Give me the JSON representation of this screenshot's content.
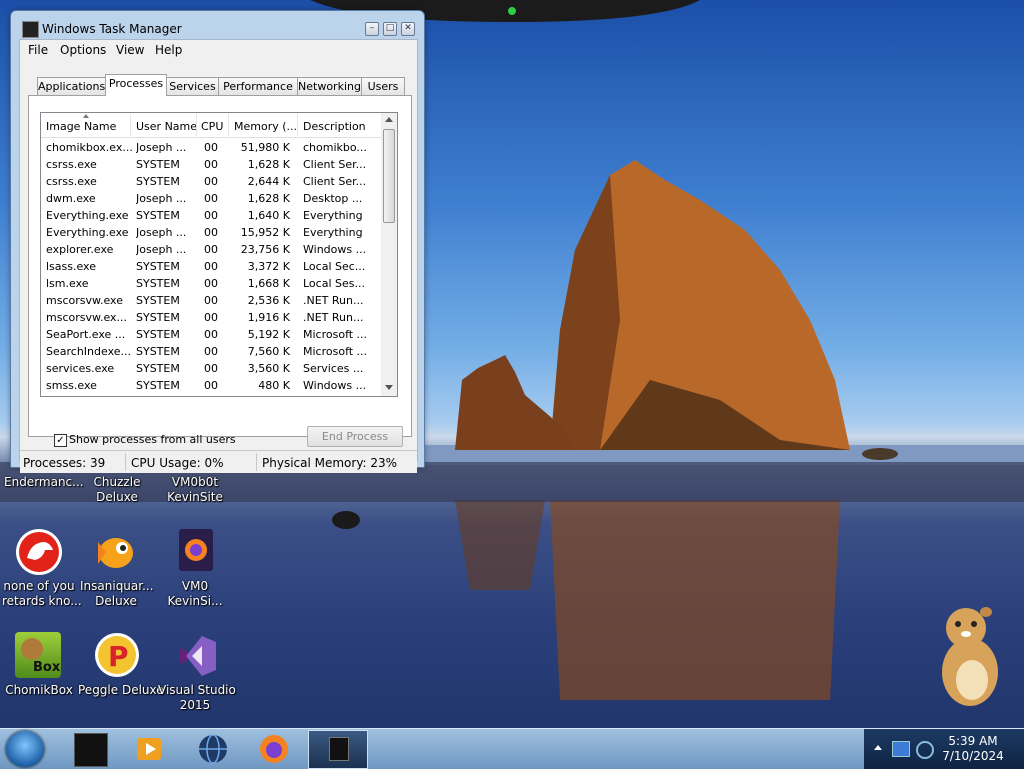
{
  "window": {
    "title": "Windows Task Manager",
    "menu": [
      "File",
      "Options",
      "View",
      "Help"
    ],
    "tabs": [
      "Applications",
      "Processes",
      "Services",
      "Performance",
      "Networking",
      "Users"
    ],
    "active_tab": "Processes",
    "columns": [
      "Image Name",
      "User Name",
      "CPU",
      "Memory (...",
      "Description"
    ],
    "processes": [
      [
        "chomikbox.ex...",
        "Joseph ...",
        "00",
        "51,980 K",
        "chomikbo..."
      ],
      [
        "csrss.exe",
        "SYSTEM",
        "00",
        "1,628 K",
        "Client Ser..."
      ],
      [
        "csrss.exe",
        "SYSTEM",
        "00",
        "2,644 K",
        "Client Ser..."
      ],
      [
        "dwm.exe",
        "Joseph ...",
        "00",
        "1,628 K",
        "Desktop ..."
      ],
      [
        "Everything.exe",
        "SYSTEM",
        "00",
        "1,640 K",
        "Everything"
      ],
      [
        "Everything.exe",
        "Joseph ...",
        "00",
        "15,952 K",
        "Everything"
      ],
      [
        "explorer.exe",
        "Joseph ...",
        "00",
        "23,756 K",
        "Windows ..."
      ],
      [
        "lsass.exe",
        "SYSTEM",
        "00",
        "3,372 K",
        "Local Sec..."
      ],
      [
        "lsm.exe",
        "SYSTEM",
        "00",
        "1,668 K",
        "Local Ses..."
      ],
      [
        "mscorsvw.exe",
        "SYSTEM",
        "00",
        "2,536 K",
        ".NET Run..."
      ],
      [
        "mscorsvw.ex...",
        "SYSTEM",
        "00",
        "1,916 K",
        ".NET Run..."
      ],
      [
        "SeaPort.exe ...",
        "SYSTEM",
        "00",
        "5,192 K",
        "Microsoft ..."
      ],
      [
        "SearchIndexe...",
        "SYSTEM",
        "00",
        "7,560 K",
        "Microsoft ..."
      ],
      [
        "services.exe",
        "SYSTEM",
        "00",
        "3,560 K",
        "Services ..."
      ],
      [
        "smss.exe",
        "SYSTEM",
        "00",
        "480 K",
        "Windows ..."
      ]
    ],
    "show_all_users_label": "Show processes from all users",
    "show_all_users_checked": true,
    "end_process_label": "End Process",
    "status": {
      "processes": "Processes: 39",
      "cpu": "CPU Usage: 0%",
      "memory": "Physical Memory: 23%"
    }
  },
  "desktop_icons": {
    "row0": {
      "endermanch": "Endermanc...",
      "chuzzle": [
        "Chuzzle",
        "Deluxe"
      ],
      "vm0b0t": [
        "VM0b0t",
        "KevinSite"
      ]
    },
    "row1": {
      "none": [
        "none of you",
        "retards kno..."
      ],
      "insaniquarium": [
        "Insaniquar...",
        "Deluxe"
      ],
      "vm0": [
        "VM0",
        "KevinSi..."
      ]
    },
    "row2": {
      "chomikbox": "ChomikBox",
      "peggle": "Peggle Deluxe",
      "visual_studio": [
        "Visual Studio",
        "2015"
      ]
    },
    "chomikbox_badge": "Box"
  },
  "taskbar": {
    "time": "5:39 AM",
    "date": "7/10/2024",
    "icons": [
      "start-orb-icon",
      "terminal-icon",
      "media-player-icon",
      "globe-icon",
      "firefox-icon",
      "task-manager-icon"
    ]
  },
  "colors": {
    "window_frame": "#bcd3ec",
    "taskbar": "#8fb3d6",
    "accent_orange": "#f58220"
  }
}
